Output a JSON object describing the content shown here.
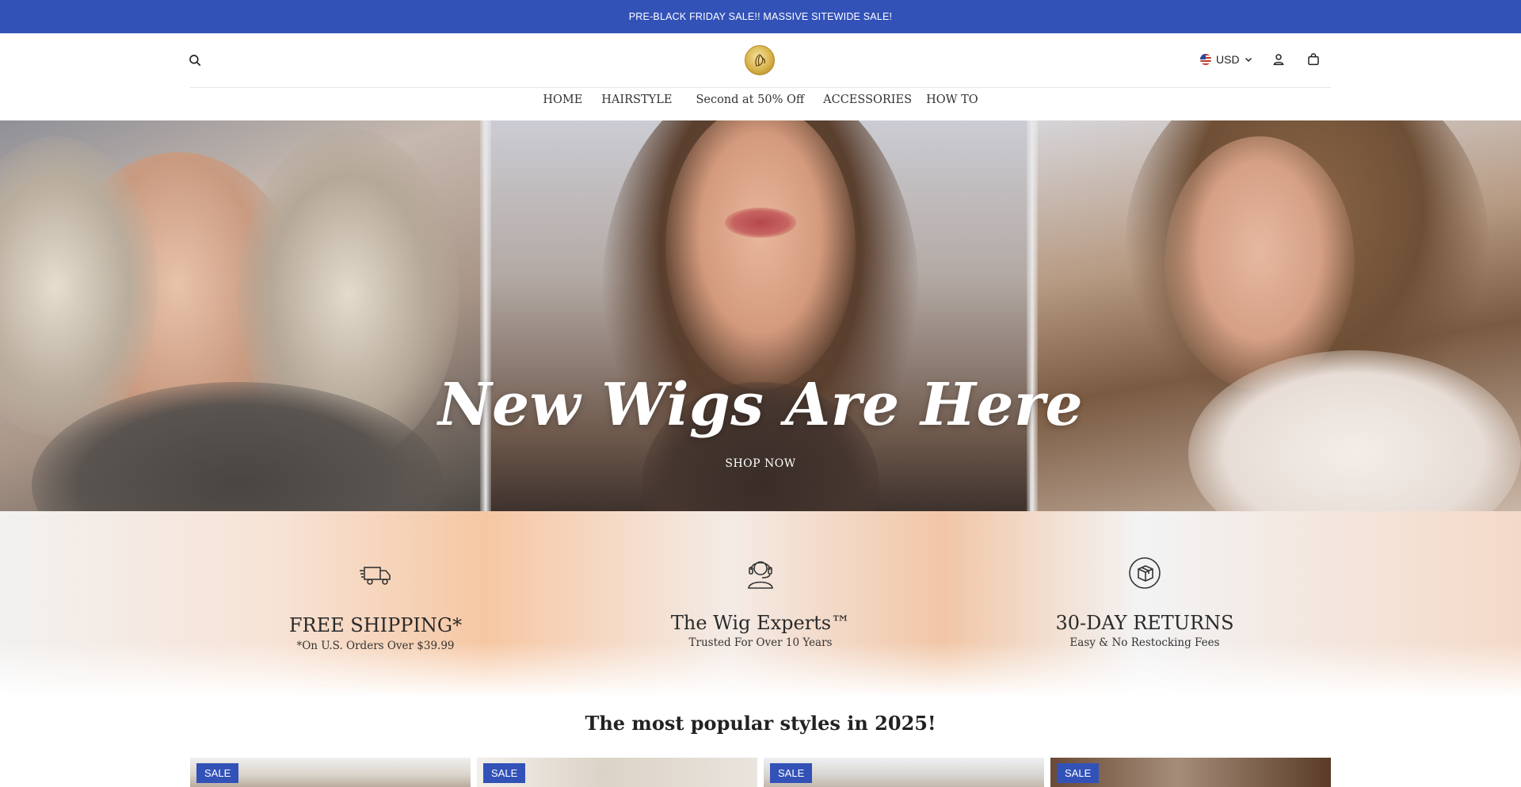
{
  "announcement": "PRE-BLACK FRIDAY SALE!!  MASSIVE SITEWIDE SALE!",
  "header": {
    "currency": "USD",
    "icons": {
      "search": "search-icon",
      "account": "user-icon",
      "cart": "bag-icon",
      "logo": "brand-logo"
    }
  },
  "nav": {
    "items": [
      "HOME",
      "HAIRSTYLE",
      "Second at 50% Off",
      "ACCESSORIES",
      "HOW TO"
    ]
  },
  "hero": {
    "title": "New Wigs Are Here",
    "cta": "SHOP NOW"
  },
  "features": [
    {
      "icon": "truck-icon",
      "title": "FREE SHIPPING*",
      "subtitle": "*On U.S. Orders Over $39.99"
    },
    {
      "icon": "headset-icon",
      "title": "The Wig Experts™",
      "subtitle": "Trusted For Over 10 Years"
    },
    {
      "icon": "box-return-icon",
      "title": "30-DAY RETURNS",
      "subtitle": "Easy & No Restocking Fees"
    }
  ],
  "popular": {
    "heading": "The most popular styles in 2025!",
    "cards": [
      {
        "badge": "SALE"
      },
      {
        "badge": "SALE"
      },
      {
        "badge": "SALE"
      },
      {
        "badge": "SALE"
      }
    ]
  },
  "colors": {
    "accent": "#3352b8",
    "text": "#222222"
  }
}
